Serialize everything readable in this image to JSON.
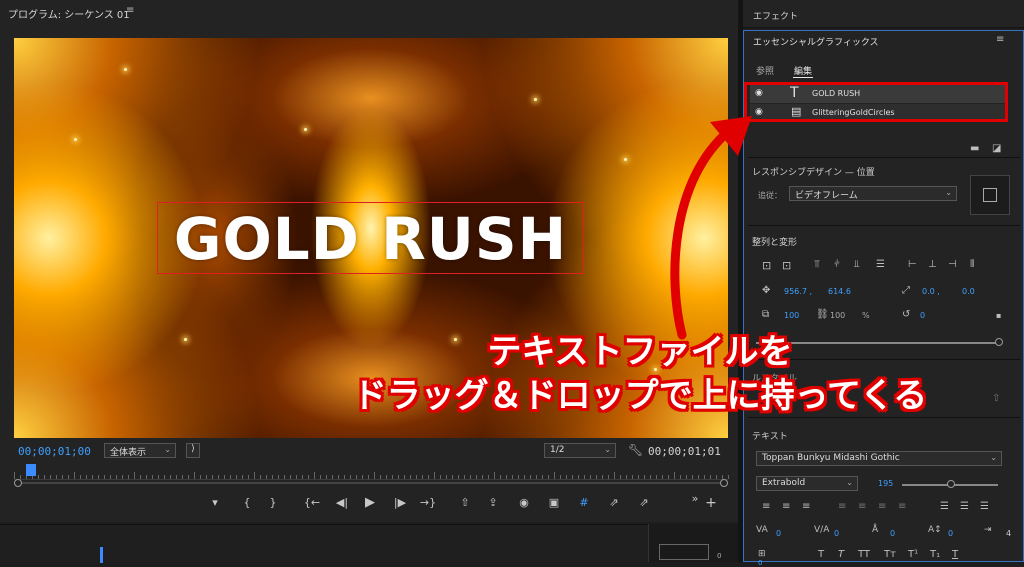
{
  "program": {
    "title": "プログラム: シーケンス 01",
    "menu_icon": "hamburger-icon",
    "video_title": "GOLD RUSH",
    "timecode_current": "00;00;01;00",
    "zoom_select": "全体表示",
    "resolution_select": "1/2",
    "timecode_end": "00;00;01;01",
    "transport": {
      "marker": "▾",
      "in": "{",
      "out": "}",
      "go_in": "{←",
      "step_back": "◀|",
      "play": "▶",
      "step_fwd": "|▶",
      "go_out": "→}",
      "lift": "⇧",
      "extract": "⇪",
      "camera": "◉",
      "comparison": "▣",
      "safe": "#",
      "export": "⇗",
      "more": "»",
      "add": "+"
    }
  },
  "effects_panel": {
    "title": "エフェクト"
  },
  "essential": {
    "title": "エッセンシャルグラフィックス",
    "menu_icon": "hamburger-icon",
    "tabs": [
      "参照",
      "編集"
    ],
    "active_tab": "編集",
    "layers": [
      {
        "name": "GOLD RUSH",
        "icon": "text-icon"
      },
      {
        "name": "GlitteringGoldCircles",
        "icon": "film-icon"
      }
    ],
    "responsive_title": "レスポンシブデザイン — 位置",
    "follow_label": "追従：",
    "follow_value": "ビデオフレーム",
    "align_title": "整列と変形",
    "pos_x": "956.7 ,",
    "pos_y": "614.6",
    "anchor_x": "0.0 ,",
    "anchor_y": "0.0",
    "scale": "100",
    "scale_h": "100",
    "percent": "%",
    "rotation": "0",
    "style_partial": "ルスタイル",
    "text_title": "テキスト",
    "font": "Toppan Bunkyu Midashi Gothic",
    "font_style": "Extrabold",
    "font_size": "195",
    "tracking": "0",
    "kerning": "0",
    "leading": "0",
    "baseline": "0",
    "tsume": "4",
    "bottom_value": "0"
  },
  "annotation": {
    "line1": "テキストファイルを",
    "line2": "ドラッグ＆ドロップで上に持ってくる"
  },
  "timeline_value": "0",
  "colors": {
    "accent": "#3fa0ff",
    "highlight": "#e00000",
    "panel": "#232323"
  }
}
